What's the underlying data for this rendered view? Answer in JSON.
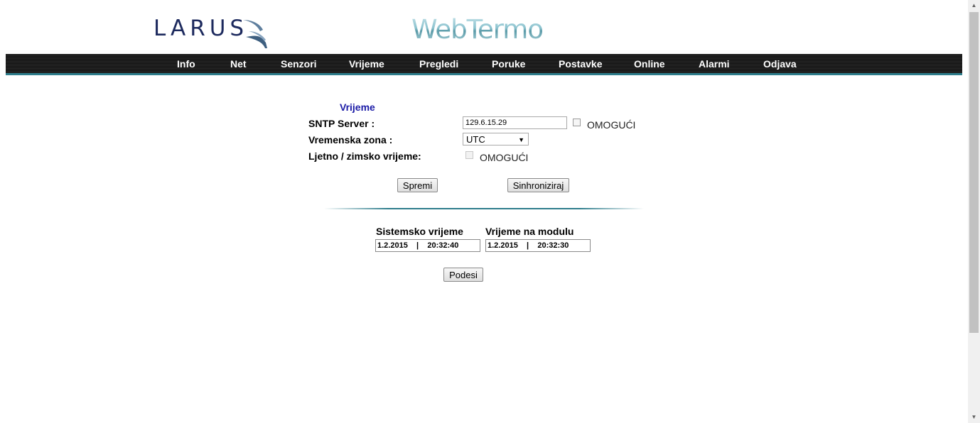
{
  "header": {
    "larus_logo": "LARUS",
    "webtermo_logo": [
      "Web",
      "Termo"
    ]
  },
  "nav": {
    "items": [
      "Info",
      "Net",
      "Senzori",
      "Vrijeme",
      "Pregledi",
      "Poruke",
      "Postavke",
      "Online",
      "Alarmi",
      "Odjava"
    ]
  },
  "form": {
    "title": "Vrijeme",
    "sntp_label": "SNTP Server :",
    "sntp_value": "129.6.15.29",
    "sntp_enable_label": "OMOGUĆI",
    "timezone_label": "Vremenska zona :",
    "timezone_value": "UTC",
    "dst_label": "Ljetno / zimsko vrijeme:",
    "dst_enable_label": "OMOGUĆI",
    "save_button": "Spremi",
    "sync_button": "Sinhroniziraj"
  },
  "times": {
    "system_label": "Sistemsko vrijeme",
    "system_value": "1.2.2015    |    20:32:40",
    "module_label": "Vrijeme na modulu",
    "module_value": "1.2.2015    |    20:32:30",
    "set_button": "Podesi"
  },
  "colors": {
    "accent": "#2e7d8c",
    "title_blue": "#1a1aa6",
    "logo_navy": "#1d2a5e"
  }
}
